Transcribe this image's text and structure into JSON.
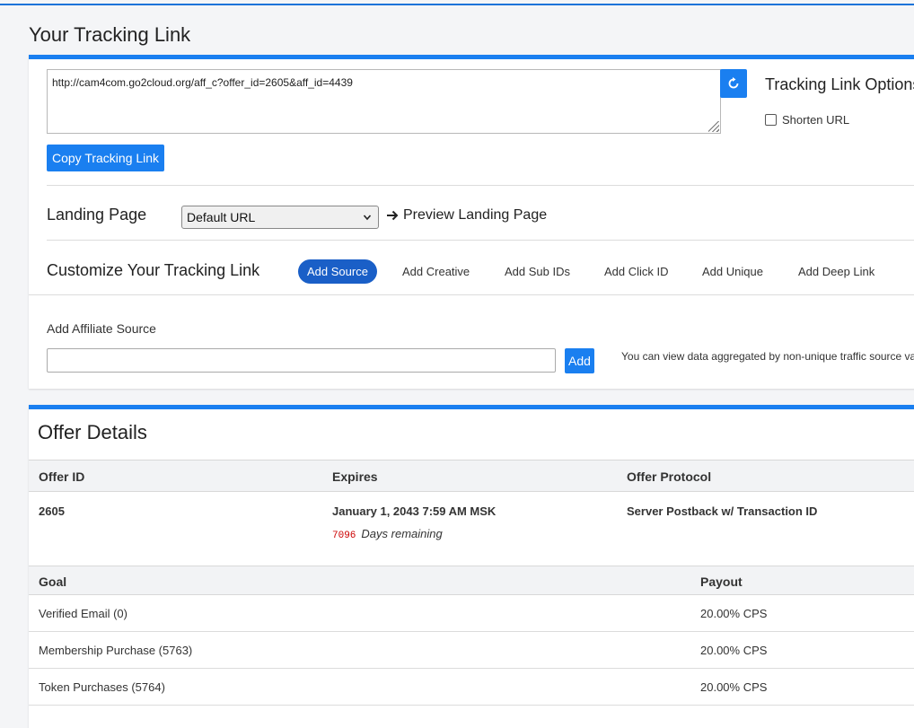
{
  "page": {
    "title": "Your Tracking Link"
  },
  "tracking": {
    "url": "http://cam4com.go2cloud.org/aff_c?offer_id=2605&aff_id=4439",
    "copy_label": "Copy Tracking Link",
    "refresh_icon": "refresh-icon",
    "options_title": "Tracking Link Options",
    "shorten_label": "Shorten URL",
    "shorten_checked": false
  },
  "landing": {
    "label": "Landing Page",
    "selected": "Default URL",
    "preview_label": "Preview Landing Page"
  },
  "customize": {
    "label": "Customize Your Tracking Link",
    "tabs": [
      "Add Source",
      "Add Creative",
      "Add Sub IDs",
      "Add Click ID",
      "Add Unique",
      "Add Deep Link"
    ],
    "active_tab": "Add Source"
  },
  "affiliate_source": {
    "label": "Add Affiliate Source",
    "value": "",
    "add_label": "Add",
    "note": "You can view data aggregated by non-unique traffic source values"
  },
  "offer": {
    "title": "Offer Details",
    "headers": [
      "Offer ID",
      "Expires",
      "Offer Protocol"
    ],
    "id": "2605",
    "expires": "January 1, 2043 7:59 AM MSK",
    "days_count": "7096",
    "days_text": "Days remaining",
    "protocol": "Server Postback w/ Transaction ID",
    "goal_headers": [
      "Goal",
      "Payout"
    ],
    "goals": [
      {
        "goal": "Verified Email (0)",
        "payout": "20.00% CPS"
      },
      {
        "goal": "Membership Purchase (5763)",
        "payout": "20.00% CPS"
      },
      {
        "goal": "Token Purchases (5764)",
        "payout": "20.00% CPS"
      }
    ]
  },
  "colors": {
    "accent": "#1a7ff0",
    "active_tab": "#1a5fc7",
    "days_count": "#cc0000"
  }
}
